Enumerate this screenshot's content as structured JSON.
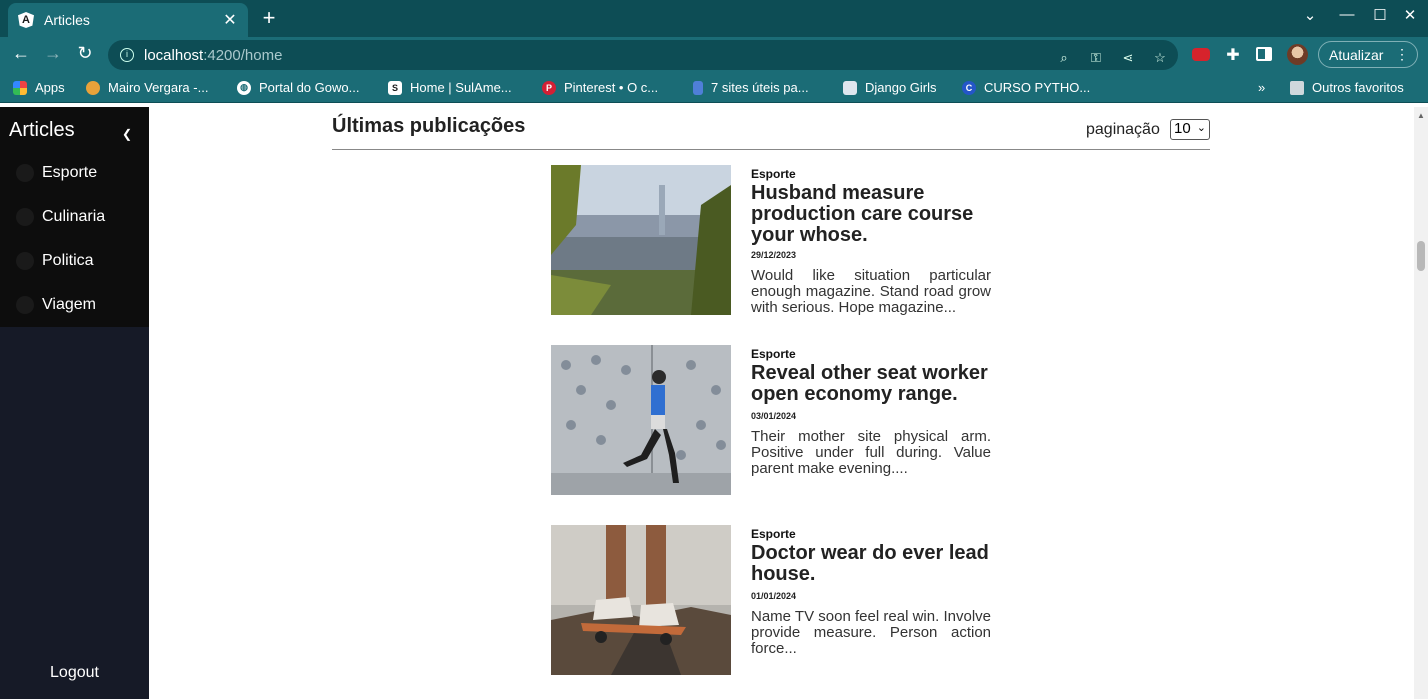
{
  "browser": {
    "tab_title": "Articles",
    "tab_favicon": "A",
    "url_host": "localhost",
    "url_path": ":4200/home",
    "update_button": "Atualizar",
    "bookmarks": [
      {
        "label": "Apps",
        "icon": "apps-grid-icon"
      },
      {
        "label": "Mairo Vergara -...",
        "icon": "site-icon"
      },
      {
        "label": "Portal do Gowo...",
        "icon": "globe-icon"
      },
      {
        "label": "Home | SulAme...",
        "icon": "s-icon"
      },
      {
        "label": "Pinterest • O c...",
        "icon": "pinterest-icon"
      },
      {
        "label": "7 sites úteis pa...",
        "icon": "bookmark-icon"
      },
      {
        "label": "Django Girls",
        "icon": "book-icon"
      },
      {
        "label": "CURSO PYTHO...",
        "icon": "c-icon"
      }
    ],
    "other_favorites": "Outros favoritos"
  },
  "sidebar": {
    "title": "Articles",
    "items": [
      {
        "label": "Esporte"
      },
      {
        "label": "Culinaria"
      },
      {
        "label": "Politica"
      },
      {
        "label": "Viagem"
      }
    ],
    "logout": "Logout"
  },
  "main": {
    "heading": "Últimas publicações",
    "pagination_label": "paginação",
    "pagination_value": "10",
    "articles": [
      {
        "category": "Esporte",
        "title": "Husband measure production care course your whose.",
        "date": "29/12/2023",
        "excerpt": "Would like situation particular enough magazine. Stand road grow with serious. Hope magazine..."
      },
      {
        "category": "Esporte",
        "title": "Reveal other seat worker open economy range.",
        "date": "03/01/2024",
        "excerpt": "Their mother site physical arm. Positive under full during. Value parent make evening...."
      },
      {
        "category": "Esporte",
        "title": "Doctor wear do ever lead house.",
        "date": "01/01/2024",
        "excerpt": "Name TV soon feel real win. Involve provide measure. Person action force..."
      }
    ]
  },
  "colors": {
    "chrome_dark": "#0d4d55",
    "chrome_light": "#1b6c76",
    "sidebar_bg": "#161a27"
  }
}
